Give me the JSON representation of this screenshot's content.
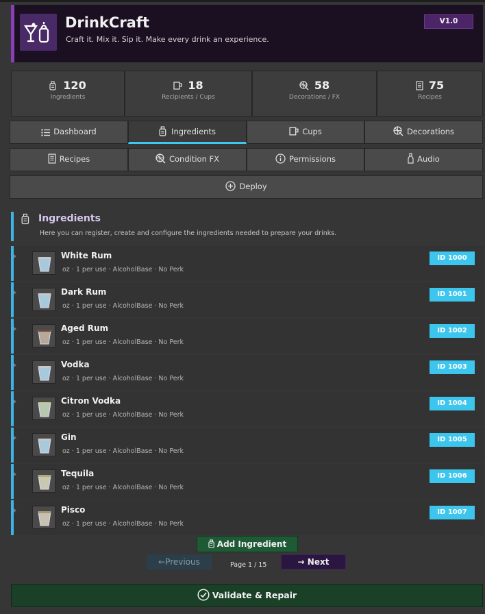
{
  "header": {
    "title": "DrinkCraft",
    "subtitle": "Craft it. Mix it. Sip it. Make every drink an experience.",
    "version": "V1.0",
    "accent": "#8a3fb8"
  },
  "stats": [
    {
      "value": "120",
      "label": "Ingredients",
      "icon": "ingredient-icon"
    },
    {
      "value": "18",
      "label": "Recipients / Cups",
      "icon": "cup-icon"
    },
    {
      "value": "58",
      "label": "Decorations / FX",
      "icon": "lemon-icon"
    },
    {
      "value": "75",
      "label": "Recipes",
      "icon": "recipe-icon"
    }
  ],
  "tabs": {
    "row1": [
      {
        "label": "Dashboard",
        "icon": "list-icon"
      },
      {
        "label": "Ingredients",
        "icon": "ingredient-icon",
        "active": true
      },
      {
        "label": "Cups",
        "icon": "cup-icon"
      },
      {
        "label": "Decorations",
        "icon": "lemon-icon"
      }
    ],
    "row2": [
      {
        "label": "Recipes",
        "icon": "recipe-icon"
      },
      {
        "label": "Condition FX",
        "icon": "lemon-icon"
      },
      {
        "label": "Permissions",
        "icon": "info-icon"
      },
      {
        "label": "Audio",
        "icon": "bottle-icon"
      }
    ],
    "deploy": {
      "label": "Deploy",
      "icon": "plus-circle-icon"
    }
  },
  "section": {
    "title": "Ingredients",
    "description": "Here you can register, create and configure the ingredients needed to prepare your drinks."
  },
  "ingredients": [
    {
      "name": "White Rum",
      "meta": "oz · 1 per use · AlcoholBase · No Perk",
      "id": "ID 1000"
    },
    {
      "name": "Dark Rum",
      "meta": "oz · 1 per use · AlcoholBase · No Perk",
      "id": "ID 1001"
    },
    {
      "name": "Aged Rum",
      "meta": "oz · 1 per use · AlcoholBase · No Perk",
      "id": "ID 1002"
    },
    {
      "name": "Vodka",
      "meta": "oz · 1 per use · AlcoholBase · No Perk",
      "id": "ID 1003"
    },
    {
      "name": "Citron Vodka",
      "meta": "oz · 1 per use · AlcoholBase · No Perk",
      "id": "ID 1004"
    },
    {
      "name": "Gin",
      "meta": "oz · 1 per use · AlcoholBase · No Perk",
      "id": "ID 1005"
    },
    {
      "name": "Tequila",
      "meta": "oz · 1 per use · AlcoholBase · No Perk",
      "id": "ID 1006"
    },
    {
      "name": "Pisco",
      "meta": "oz · 1 per use · AlcoholBase · No Perk",
      "id": "ID 1007"
    }
  ],
  "actions": {
    "add_label": "Add Ingredient",
    "prev_label": "Previous",
    "next_label": "Next",
    "page_info": "Page 1 / 15",
    "validate_label": "Validate & Repair"
  }
}
